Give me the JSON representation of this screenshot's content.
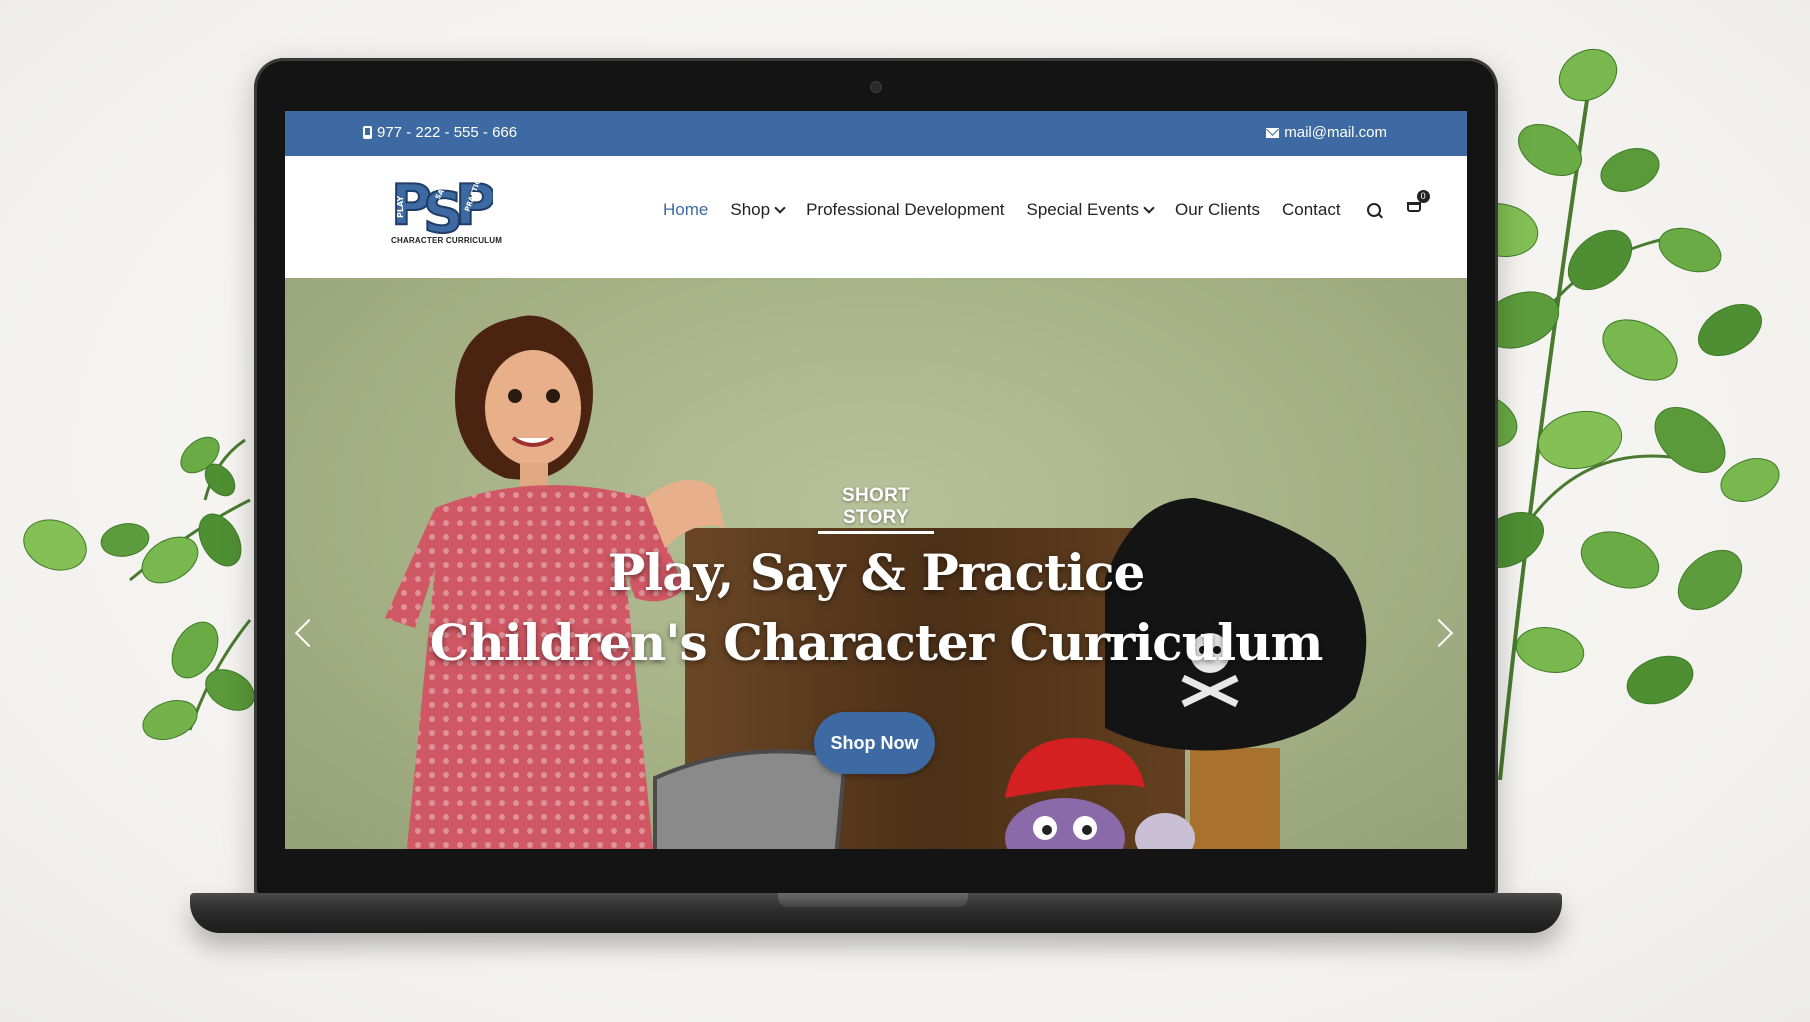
{
  "topbar": {
    "phone": "977 - 222 - 555 - 666",
    "email": "mail@mail.com",
    "phone_icon": "phone-icon",
    "email_icon": "envelope-icon"
  },
  "logo": {
    "letters": "PSP",
    "small_words": [
      "PLAY",
      "SAY",
      "PRACTICE"
    ],
    "caption": "CHARACTER CURRICULUM"
  },
  "nav": {
    "items": [
      {
        "label": "Home",
        "active": true,
        "has_dropdown": false
      },
      {
        "label": "Shop",
        "active": false,
        "has_dropdown": true
      },
      {
        "label": "Professional Development",
        "active": false,
        "has_dropdown": false
      },
      {
        "label": "Special Events",
        "active": false,
        "has_dropdown": true
      },
      {
        "label": "Our Clients",
        "active": false,
        "has_dropdown": false
      },
      {
        "label": "Contact",
        "active": false,
        "has_dropdown": false
      }
    ],
    "cart_count": "0"
  },
  "hero": {
    "eyebrow": "SHORT STORY",
    "headline_line1": "Play, Say & Practice",
    "headline_line2": "Children's Character Curriculum",
    "button_label": "Shop Now"
  },
  "colors": {
    "brand_blue": "#3d6aa3",
    "text_dark": "#222222",
    "background": "#f4f3f1"
  }
}
